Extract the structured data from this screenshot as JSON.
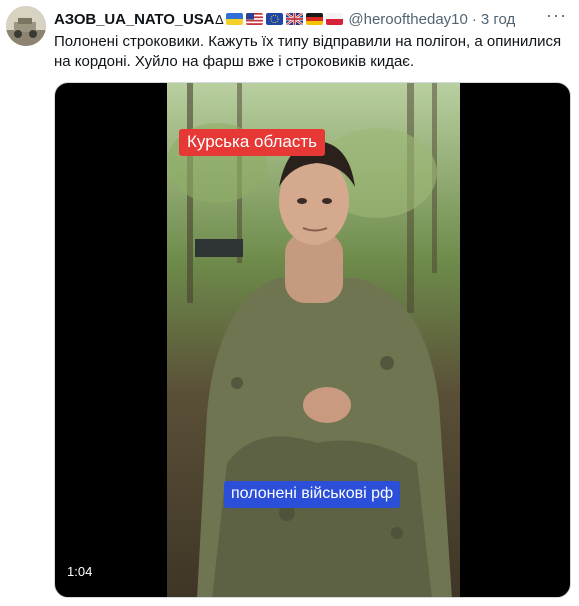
{
  "tweet": {
    "display_name": "АЗОВ_UA_NATO_USA",
    "name_symbol": "∆",
    "flags": [
      "ua-flag",
      "us-flag",
      "eu-flag",
      "uk-flag",
      "de-flag",
      "pl-flag"
    ],
    "handle": "@heroofthеday10",
    "separator": "·",
    "timestamp": "3 год",
    "more_label": "···",
    "text": "Полонені строковики. Кажуть їх типу відправили на полігон, а опинилися на кордоні. Хуйло на фарш вже і строковиків кидає."
  },
  "video": {
    "caption_top": "Курська область",
    "caption_bottom": "полонені військові рф",
    "duration": "1:04"
  },
  "colors": {
    "caption_top_bg": "#e63935",
    "caption_bottom_bg": "#2b4fd8",
    "secondary_text": "#536471"
  }
}
